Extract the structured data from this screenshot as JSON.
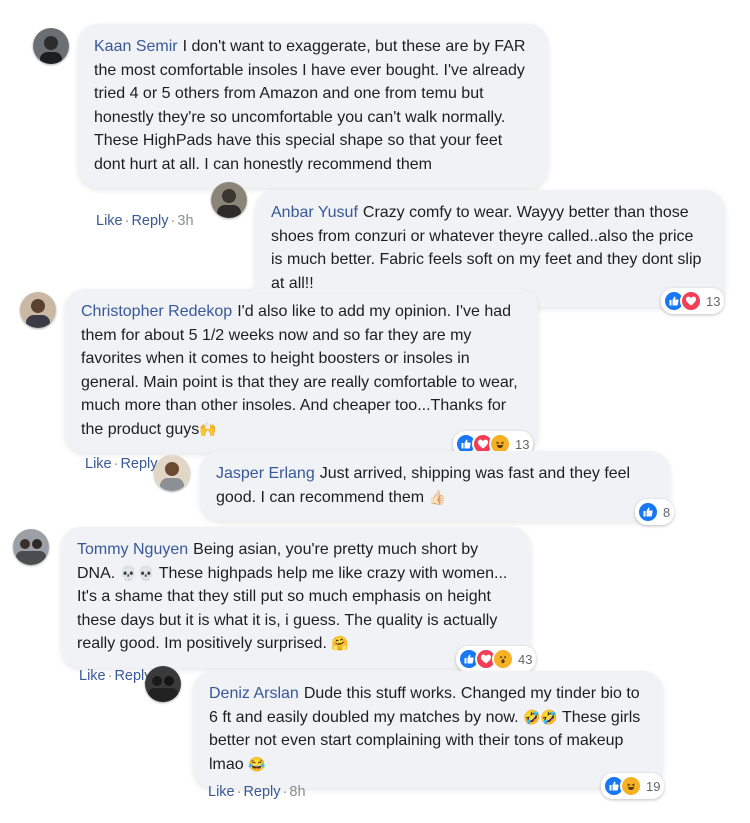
{
  "colors": {
    "name": "#385898",
    "bubble": "#f0f2f5",
    "like": "#1877f2",
    "love": "#f33e58",
    "haha": "#f7b125"
  },
  "actions": {
    "like": "Like",
    "reply": "Reply",
    "separator": "·"
  },
  "comments": [
    {
      "author": "Kaan Semir",
      "text": "I don't want to exaggerate, but these are by FAR the most comfortable insoles I have ever bought. I've already tried 4 or 5 others from Amazon and one from temu but honestly they're so uncomfortable you can't walk normally. These HighPads have this special shape so that your feet dont hurt at all. I can honestly recommend them",
      "time": "3h"
    },
    {
      "author": "Anbar Yusuf",
      "text": "Crazy comfy to wear. Wayyy better than those shoes from conzuri or whatever theyre called..also the price is much better. Fabric feels soft on my feet and they dont slip at all!!",
      "reactions": [
        "like-icon",
        "love-icon"
      ],
      "reaction_count": "13"
    },
    {
      "author": "Christopher Redekop",
      "text": "I'd also like to add my opinion. I've had them for about 5 1/2 weeks now and so far they are my favorites when it comes to height boosters or insoles in general. Main point is that they are really comfortable to wear, much more than other insoles. And cheaper too...Thanks for the product guys",
      "emoji": "🙌",
      "reactions": [
        "like-icon",
        "love-icon",
        "haha-icon"
      ],
      "reaction_count": "13"
    },
    {
      "author": "Jasper Erlang",
      "text": "Just arrived, shipping was fast and they feel good. I can recommend them",
      "emoji": "👍🏻",
      "reactions": [
        "like-icon"
      ],
      "reaction_count": "8"
    },
    {
      "author": "Tommy Nguyen",
      "text_a": "Being asian, you're pretty much short by DNA.",
      "emoji_a": "💀💀",
      "text_b": "These highpads help me like crazy with women... It's a shame that they still put so much emphasis on height these days but it is what it is, i guess. The quality is actually really good. Im positively surprised.",
      "emoji_b": "🤗",
      "reactions": [
        "like-icon",
        "love-icon",
        "wow-icon"
      ],
      "reaction_count": "43"
    },
    {
      "author": "Deniz Arslan",
      "text_a": "Dude this stuff works. Changed my tinder bio to 6 ft and easily doubled my matches by now.",
      "emoji_a": "🤣🤣",
      "text_b": "These girls better not even start complaining with their tons of makeup lmao",
      "emoji_b": "😂",
      "reactions": [
        "like-icon",
        "haha-icon"
      ],
      "reaction_count": "19",
      "time": "8h"
    }
  ]
}
